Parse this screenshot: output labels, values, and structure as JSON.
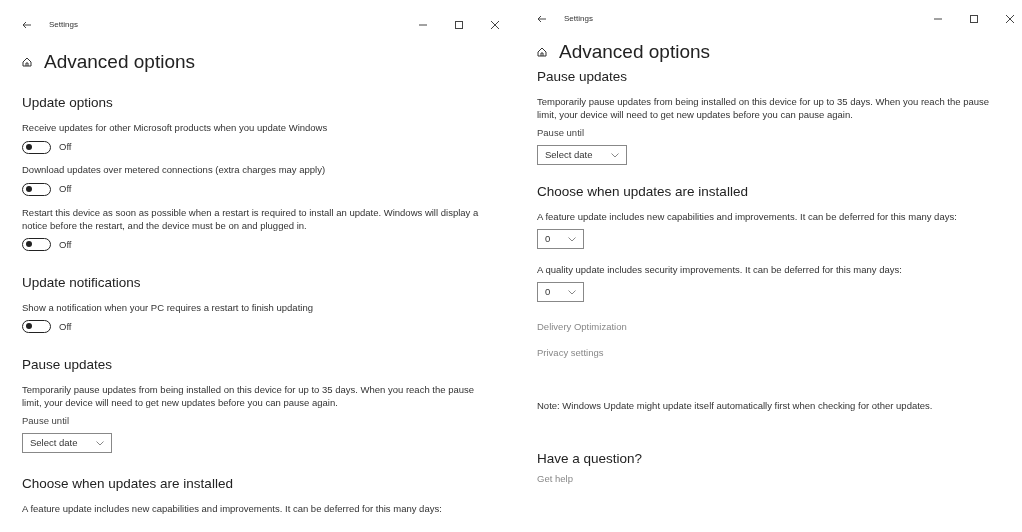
{
  "windows": [
    {
      "title": "Settings",
      "heading": "Advanced options",
      "blocks": [
        {
          "kind": "section",
          "text": "Update options"
        },
        {
          "kind": "text",
          "text": "Receive updates for other Microsoft products when you update Windows"
        },
        {
          "kind": "toggle",
          "on": false,
          "text": "Off"
        },
        {
          "kind": "text",
          "text": "Download updates over metered connections (extra charges may apply)"
        },
        {
          "kind": "toggle",
          "on": false,
          "text": "Off"
        },
        {
          "kind": "text",
          "text": "Restart this device as soon as possible when a restart is required to install an update. Windows will display a notice before the restart, and the device must be on and plugged in."
        },
        {
          "kind": "toggle",
          "on": false,
          "text": "Off"
        },
        {
          "kind": "section",
          "text": "Update notifications"
        },
        {
          "kind": "text",
          "text": "Show a notification when your PC requires a restart to finish updating"
        },
        {
          "kind": "toggle",
          "on": false,
          "text": "Off"
        },
        {
          "kind": "section",
          "text": "Pause updates"
        },
        {
          "kind": "text",
          "text": "Temporarily pause updates from being installed on this device for up to 35 days. When you reach the pause limit, your device will need to get new updates before you can pause again."
        },
        {
          "kind": "label",
          "text": "Pause until"
        },
        {
          "kind": "dropdown",
          "text": "Select date"
        },
        {
          "kind": "section",
          "text": "Choose when updates are installed"
        },
        {
          "kind": "text",
          "text": "A feature update includes new capabilities and improvements. It can be deferred for this many days:"
        }
      ]
    },
    {
      "title": "Settings",
      "heading": "Advanced options",
      "blocks": [
        {
          "kind": "section",
          "text": "Pause updates"
        },
        {
          "kind": "text",
          "text": "Temporarily pause updates from being installed on this device for up to 35 days. When you reach the pause limit, your device will need to get new updates before you can pause again."
        },
        {
          "kind": "label",
          "text": "Pause until"
        },
        {
          "kind": "dropdown",
          "text": "Select date"
        },
        {
          "kind": "section",
          "text": "Choose when updates are installed"
        },
        {
          "kind": "text",
          "text": "A feature update includes new capabilities and improvements. It can be deferred for this many days:"
        },
        {
          "kind": "dropdown",
          "text": "0"
        },
        {
          "kind": "text",
          "text": "A quality update includes security improvements. It can be deferred for this many days:"
        },
        {
          "kind": "dropdown",
          "text": "0"
        },
        {
          "kind": "link",
          "text": "Delivery Optimization"
        },
        {
          "kind": "link",
          "text": "Privacy settings"
        },
        {
          "kind": "note",
          "text": "Note: Windows Update might update itself automatically first when checking for other updates."
        },
        {
          "kind": "question",
          "text": "Have a question?"
        },
        {
          "kind": "link",
          "text": "Get help"
        }
      ]
    }
  ]
}
